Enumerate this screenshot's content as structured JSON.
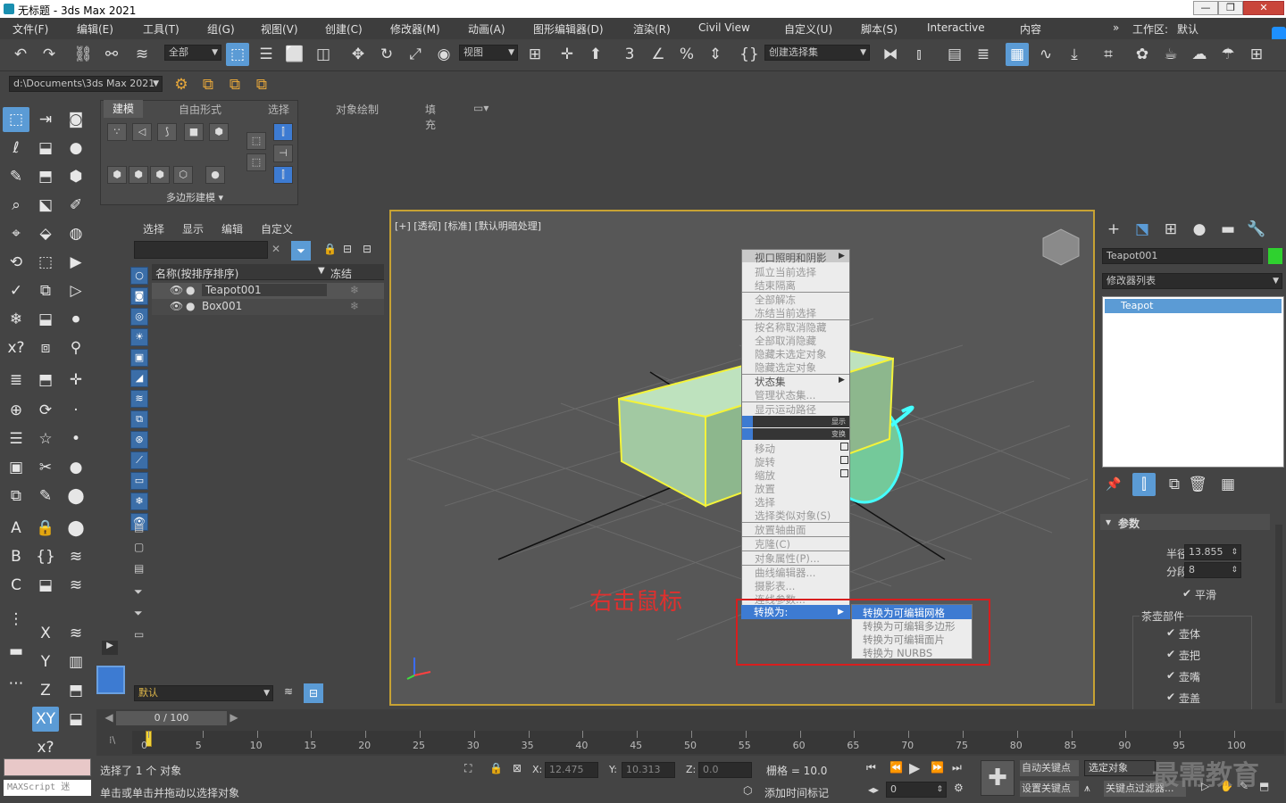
{
  "window": {
    "title": "无标题 - 3ds Max 2021",
    "min_icon": "minimize-icon",
    "max_icon": "maximize-icon",
    "close_icon": "close-icon"
  },
  "menu": {
    "items": [
      "文件(F)",
      "编辑(E)",
      "工具(T)",
      "组(G)",
      "视图(V)",
      "创建(C)",
      "修改器(M)",
      "动画(A)",
      "图形编辑器(D)",
      "渲染(R)",
      "Civil View",
      "自定义(U)",
      "脚本(S)",
      "Interactive",
      "内容"
    ],
    "workspace_label": "工作区:",
    "workspace_value": "默认"
  },
  "toolbar": {
    "selection_filter": "全部",
    "ref_coord": "视图",
    "named_selection": "创建选择集",
    "path": "d:\\Documents\\3ds Max 2021"
  },
  "ribbon": {
    "tabs": [
      "建模",
      "自由形式",
      "选择",
      "对象绘制",
      "填充"
    ],
    "footer": "多边形建模"
  },
  "scene_explorer": {
    "menu": [
      "选择",
      "显示",
      "编辑",
      "自定义"
    ],
    "col_name": "名称(按排序排序)",
    "col_freeze": "冻结",
    "rows": [
      "Teapot001",
      "Box001"
    ],
    "layer": "默认"
  },
  "viewport": {
    "label": "[+] [透视] [标准] [默认明暗处理]",
    "annotation": "右击鼠标"
  },
  "context_menu": {
    "items": [
      "视口照明和阴影",
      "孤立当前选择",
      "结束隔离",
      "全部解冻",
      "冻结当前选择",
      "按名称取消隐藏",
      "全部取消隐藏",
      "隐藏未选定对象",
      "隐藏选定对象",
      "状态集",
      "管理状态集...",
      "显示运动路径"
    ],
    "header_display": "显示",
    "header_transform": "变换",
    "transform_items": [
      "移动",
      "旋转",
      "缩放",
      "放置",
      "选择",
      "选择类似对象(S)",
      "放置轴曲面",
      "克隆(C)",
      "对象属性(P)...",
      "曲线编辑器...",
      "摄影表...",
      "连线参数..."
    ],
    "convert": "转换为:",
    "submenu": [
      "转换为可编辑网格",
      "转换为可编辑多边形",
      "转换为可编辑面片",
      "转换为 NURBS"
    ]
  },
  "command_panel": {
    "object_name": "Teapot001",
    "object_color": "#2fd12f",
    "modifier_list": "修改器列表",
    "stack_item": "Teapot",
    "params_title": "参数",
    "radius_label": "半径:",
    "radius_value": "13.855",
    "segments_label": "分段:",
    "segments_value": "8",
    "smooth": "平滑",
    "parts_title": "茶壶部件",
    "parts": [
      "壶体",
      "壶把",
      "壶嘴",
      "壶盖"
    ]
  },
  "timeline": {
    "frame": "0 / 100",
    "ticks": [
      "0",
      "5",
      "10",
      "15",
      "20",
      "25",
      "30",
      "35",
      "40",
      "45",
      "50",
      "55",
      "60",
      "65",
      "70",
      "75",
      "80",
      "85",
      "90",
      "95",
      "100"
    ]
  },
  "status": {
    "selected": "选择了 1 个 对象",
    "hint": "单击或单击并拖动以选择对象",
    "maxscript": "MAXScript 迷",
    "x_label": "X:",
    "x": "12.475",
    "y_label": "Y:",
    "y": "10.313",
    "z_label": "Z:",
    "z": "0.0",
    "grid": "栅格 = 10.0",
    "add_time_tag": "添加时间标记",
    "auto_key": "自动关键点",
    "selected_obj": "选定对象",
    "set_key": "设置关键点",
    "key_filter": "关键点过滤器...",
    "frame_spinner": "0",
    "watermark": "最需教育"
  }
}
